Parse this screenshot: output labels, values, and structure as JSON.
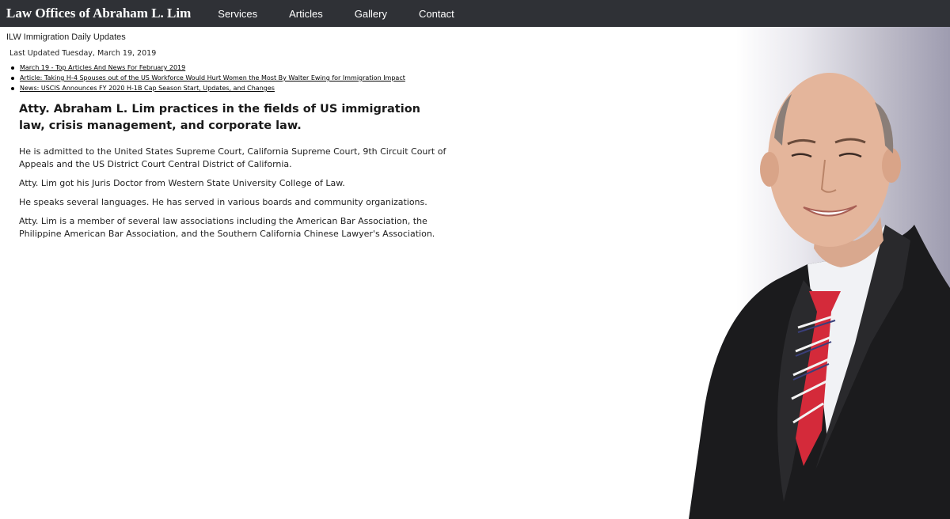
{
  "nav": {
    "brand": "Law Offices of Abraham L. Lim",
    "links": [
      "Services",
      "Articles",
      "Gallery",
      "Contact"
    ]
  },
  "widget": {
    "title": "ILW Immigration Daily Updates",
    "last_updated": "Last Updated Tuesday, March 19, 2019",
    "news": [
      "March 19 - Top Articles And News For February 2019",
      "Article: Taking H-4 Spouses out of the US Workforce Would Hurt Women the Most By Walter Ewing for Immigration Impact",
      "News: USCIS Announces FY 2020 H-1B Cap Season Start, Updates, and Changes"
    ]
  },
  "main": {
    "headline": "Atty. Abraham L. Lim practices in the fields of US immigration law, crisis management, and corporate law.",
    "paragraphs": [
      "He is admitted to the United States Supreme Court, California Supreme Court, 9th Circuit Court of Appeals and the US District Court Central District of California.",
      "Atty. Lim got his Juris Doctor from Western State University College of Law.",
      "He speaks several languages. He has served in various boards and community organizations.",
      "Atty. Lim is a member of several law associations including the American Bar Association, the Philippine American Bar Association, and the Southern California Chinese Lawyer's Association."
    ]
  },
  "colors": {
    "nav_bg": "#2f3136",
    "tie_red": "#d42a3a",
    "suit": "#1b1b1d"
  }
}
